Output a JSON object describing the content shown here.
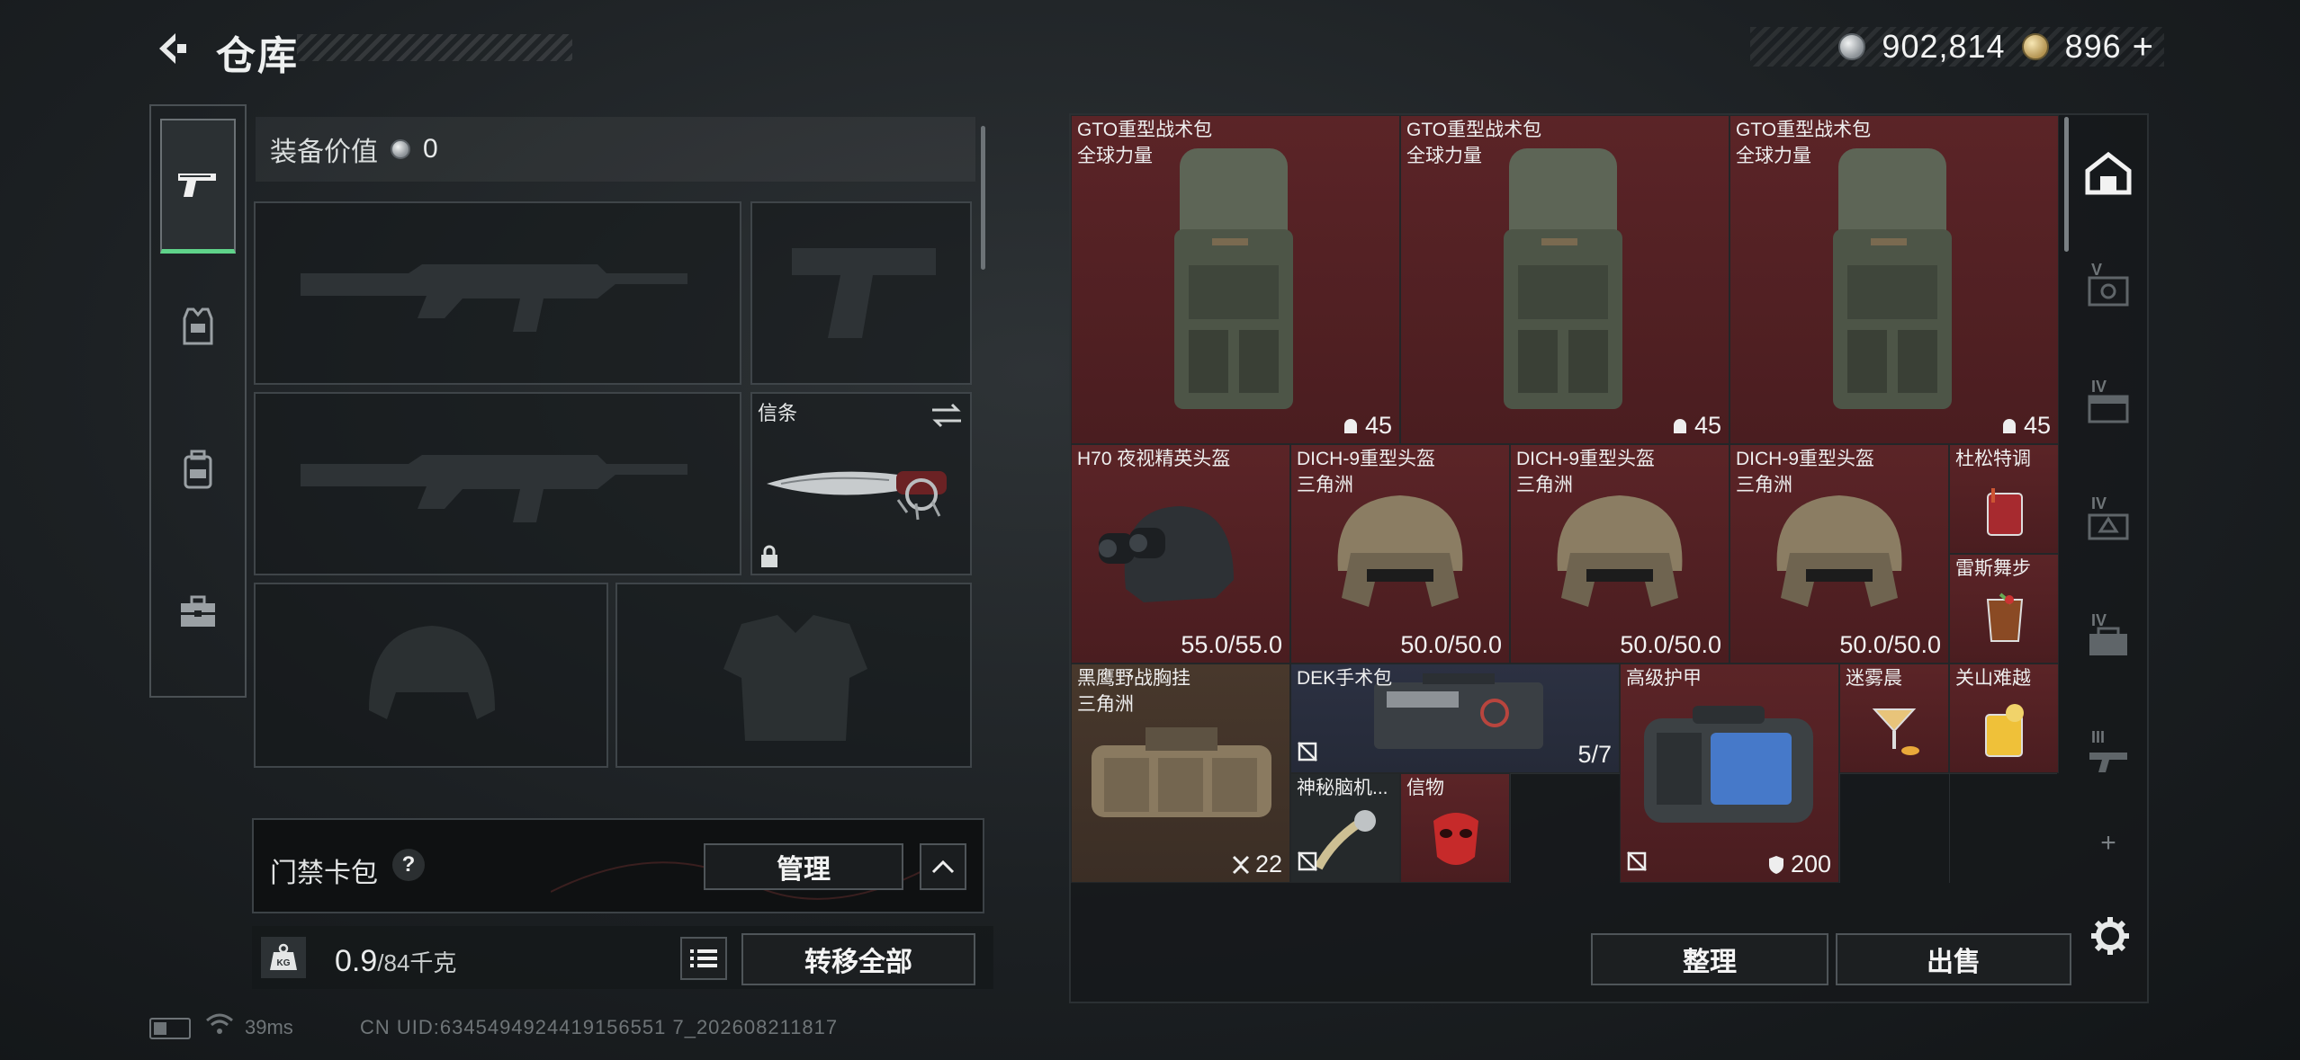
{
  "header": {
    "title": "仓库",
    "back_icon": "back-arrow-icon"
  },
  "currency": {
    "silver_value": "902,814",
    "gold_value": "896",
    "plus_label": "+",
    "silver_icon": "silver-coin-icon",
    "gold_icon": "gold-coin-icon"
  },
  "categories": [
    {
      "name": "weapons",
      "icon": "pistol-icon",
      "active": true
    },
    {
      "name": "gear",
      "icon": "vest-icon",
      "active": false
    },
    {
      "name": "backpack",
      "icon": "backpack-icon",
      "active": false
    },
    {
      "name": "toolbox",
      "icon": "toolbox-icon",
      "active": false
    }
  ],
  "loadout": {
    "value_label": "装备价值",
    "value_num": "0",
    "melee_label": "信条"
  },
  "keycard": {
    "label": "门禁卡包",
    "help": "?",
    "manage_label": "管理"
  },
  "weight": {
    "current": "0.9",
    "max": "/84千克",
    "transfer_label": "转移全部"
  },
  "status": {
    "ping": "39ms",
    "uid": "CN UID:6345494924419156551 7_202608211817"
  },
  "storage": {
    "items": [
      {
        "name": "GTO重型战术包",
        "sub": "全球力量",
        "count": "45",
        "count_icon": "ghost-icon"
      },
      {
        "name": "GTO重型战术包",
        "sub": "全球力量",
        "count": "45",
        "count_icon": "ghost-icon"
      },
      {
        "name": "GTO重型战术包",
        "sub": "全球力量",
        "count": "45",
        "count_icon": "ghost-icon"
      },
      {
        "name": "H70 夜视精英头盔",
        "sub": "",
        "count": "55.0/55.0"
      },
      {
        "name": "DICH-9重型头盔",
        "sub": "三角洲",
        "count": "50.0/50.0"
      },
      {
        "name": "DICH-9重型头盔",
        "sub": "三角洲",
        "count": "50.0/50.0"
      },
      {
        "name": "DICH-9重型头盔",
        "sub": "三角洲",
        "count": "50.0/50.0"
      },
      {
        "name": "杜松特调",
        "sub": ""
      },
      {
        "name": "雷斯舞步",
        "sub": ""
      },
      {
        "name": "黑鹰野战胸挂",
        "sub": "三角洲",
        "count": "22",
        "count_icon": "capacity-icon"
      },
      {
        "name": "DEK手术包",
        "sub": "",
        "count": "5/7"
      },
      {
        "name": "高级护甲",
        "sub": "",
        "count": "200",
        "count_icon": "shield-icon"
      },
      {
        "name": "迷雾晨",
        "sub": ""
      },
      {
        "name": "关山难越",
        "sub": ""
      },
      {
        "name": "神秘脑机...",
        "sub": ""
      },
      {
        "name": "信物",
        "sub": ""
      }
    ],
    "sort_label": "整理",
    "sell_label": "出售"
  },
  "rail": [
    {
      "tier": "",
      "icon": "storage-home-icon"
    },
    {
      "tier": "V",
      "icon": "safe-icon"
    },
    {
      "tier": "IV",
      "icon": "crate-icon"
    },
    {
      "tier": "IV",
      "icon": "ammo-box-icon"
    },
    {
      "tier": "IV",
      "icon": "medical-crate-icon"
    },
    {
      "tier": "III",
      "icon": "gun-case-icon"
    }
  ],
  "rail_plus": "+",
  "colors": {
    "accent_green": "#5fd38a",
    "item_red": "#5b2427",
    "item_brown": "#48382c",
    "item_blue": "#2c3142"
  }
}
